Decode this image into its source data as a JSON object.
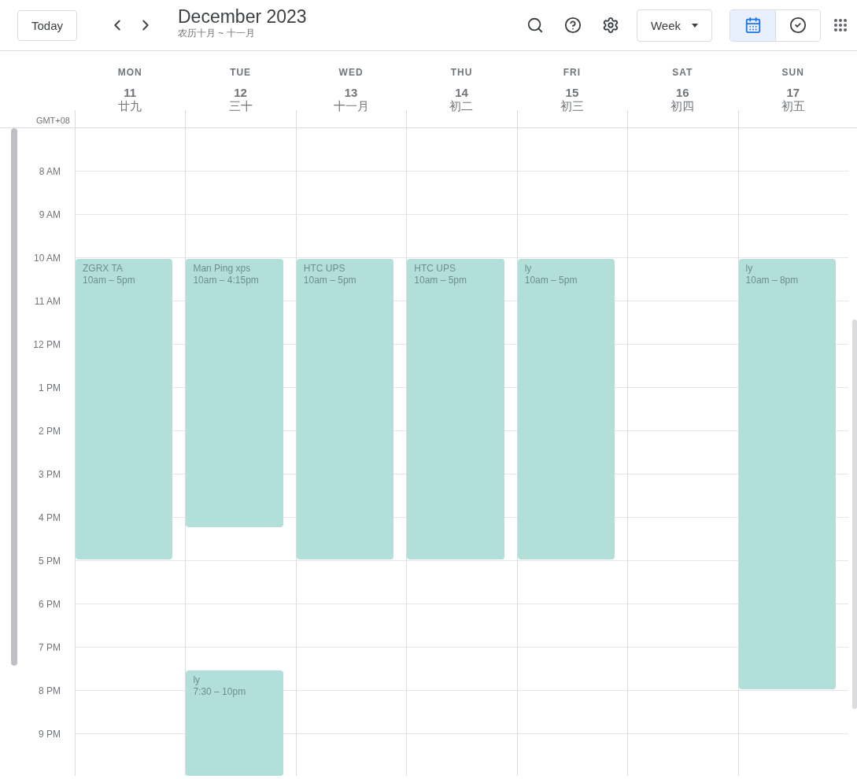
{
  "toolbar": {
    "today": "Today",
    "title": "December 2023",
    "subtitle": "农历十月 ~ 十一月",
    "view_menu": "Week",
    "views": [
      {
        "kind": "calendar",
        "selected": true
      },
      {
        "kind": "tasks",
        "selected": false
      }
    ]
  },
  "timezone": "GMT+08",
  "hours": [
    "8 AM",
    "9 AM",
    "10 AM",
    "11 AM",
    "12 PM",
    "1 PM",
    "2 PM",
    "3 PM",
    "4 PM",
    "5 PM",
    "6 PM",
    "7 PM",
    "8 PM",
    "9 PM"
  ],
  "days": [
    {
      "name": "MON",
      "date": "11",
      "lunar": "廿九",
      "events": [
        {
          "title": "ZGRX TA",
          "time": "10am – 5pm"
        }
      ]
    },
    {
      "name": "TUE",
      "date": "12",
      "lunar": "三十",
      "events": [
        {
          "title": "Man Ping xps",
          "time": "10am – 4:15pm"
        },
        {
          "title": "ly",
          "time": "7:30 – 10pm"
        }
      ]
    },
    {
      "name": "WED",
      "date": "13",
      "lunar": "十一月",
      "events": [
        {
          "title": "HTC UPS",
          "time": "10am – 5pm"
        }
      ]
    },
    {
      "name": "THU",
      "date": "14",
      "lunar": "初二",
      "events": [
        {
          "title": "HTC UPS",
          "time": "10am – 5pm"
        }
      ]
    },
    {
      "name": "FRI",
      "date": "15",
      "lunar": "初三",
      "events": [
        {
          "title": "ly",
          "time": "10am – 5pm"
        }
      ]
    },
    {
      "name": "SAT",
      "date": "16",
      "lunar": "初四"
    },
    {
      "name": "SUN",
      "date": "17",
      "lunar": "初五",
      "events": [
        {
          "title": "ly",
          "time": "10am – 8pm"
        }
      ]
    }
  ]
}
